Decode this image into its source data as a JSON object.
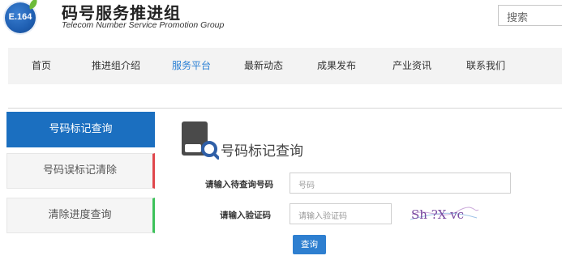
{
  "header": {
    "logo_text": "E.164",
    "title": "码号服务推进组",
    "subtitle": "Telecom Number Service  Promotion Group",
    "search_placeholder": "搜索"
  },
  "nav": {
    "items": [
      {
        "label": "首页",
        "active": false
      },
      {
        "label": "推进组介绍",
        "active": false
      },
      {
        "label": "服务平台",
        "active": true
      },
      {
        "label": "最新动态",
        "active": false
      },
      {
        "label": "成果发布",
        "active": false
      },
      {
        "label": "产业资讯",
        "active": false
      },
      {
        "label": "联系我们",
        "active": false
      }
    ]
  },
  "sidebar": {
    "items": [
      {
        "label": "号码标记查询",
        "active": true
      },
      {
        "label": "号码误标记清除",
        "accent": "#e0474c"
      },
      {
        "label": "清除进度查询",
        "accent": "#3cc25a"
      }
    ]
  },
  "main": {
    "title": "号码标记查询",
    "number_label": "请输入待查询号码",
    "number_placeholder": "号码",
    "captcha_label": "请输入验证码",
    "captcha_placeholder": "请输入验证码",
    "captcha_text": "Sh ?X vc",
    "query_button": "查询"
  },
  "colors": {
    "primary": "#1b6fc0",
    "nav_active": "#2a7fd4",
    "nav_bg": "#f3f3f3"
  }
}
